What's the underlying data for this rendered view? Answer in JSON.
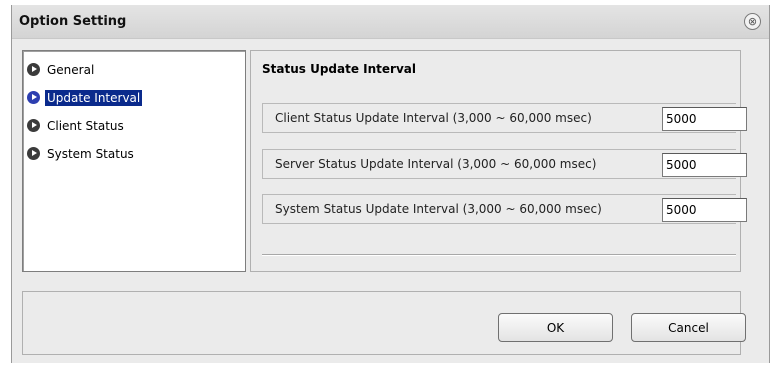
{
  "window": {
    "title": "Option Setting",
    "close_glyph": "⊗"
  },
  "sidebar": {
    "items": [
      {
        "label": "General",
        "icon": "arrow-circle-icon",
        "selected": false
      },
      {
        "label": "Update Interval",
        "icon": "arrow-circle-icon",
        "selected": true
      },
      {
        "label": "Client Status",
        "icon": "arrow-circle-icon",
        "selected": false
      },
      {
        "label": "System Status",
        "icon": "arrow-circle-icon",
        "selected": false
      }
    ]
  },
  "content": {
    "section_title": "Status Update Interval",
    "rows": [
      {
        "label": "Client Status Update Interval (3,000 ~ 60,000 msec)",
        "value": "5000"
      },
      {
        "label": "Server Status Update Interval (3,000 ~ 60,000 msec)",
        "value": "5000"
      },
      {
        "label": "System Status Update Interval (3,000 ~ 60,000 msec)",
        "value": "5000"
      }
    ]
  },
  "buttons": {
    "ok_label": "OK",
    "cancel_label": "Cancel"
  },
  "colors": {
    "selection": "#0a2a8c",
    "window_bg": "#ebebeb"
  }
}
